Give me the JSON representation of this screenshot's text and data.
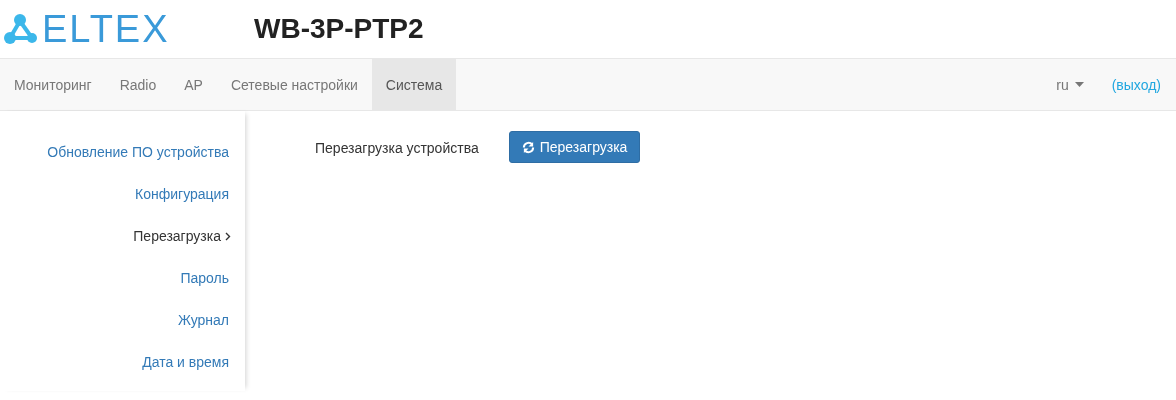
{
  "header": {
    "logo_text": "ELTEX",
    "device_title": "WB-3P-PTP2"
  },
  "nav": {
    "tabs": [
      {
        "label": "Мониторинг",
        "selected": false
      },
      {
        "label": "Radio",
        "selected": false
      },
      {
        "label": "AP",
        "selected": false
      },
      {
        "label": "Сетевые настройки",
        "selected": false
      },
      {
        "label": "Система",
        "selected": true
      }
    ],
    "language": "ru",
    "logout": "(выход)"
  },
  "sidebar": {
    "items": [
      {
        "label": "Обновление ПО устройства",
        "selected": false
      },
      {
        "label": "Конфигурация",
        "selected": false
      },
      {
        "label": "Перезагрузка",
        "selected": true
      },
      {
        "label": "Пароль",
        "selected": false
      },
      {
        "label": "Журнал",
        "selected": false
      },
      {
        "label": "Дата и время",
        "selected": false
      }
    ]
  },
  "content": {
    "label": "Перезагрузка устройства",
    "button": "Перезагрузка"
  }
}
